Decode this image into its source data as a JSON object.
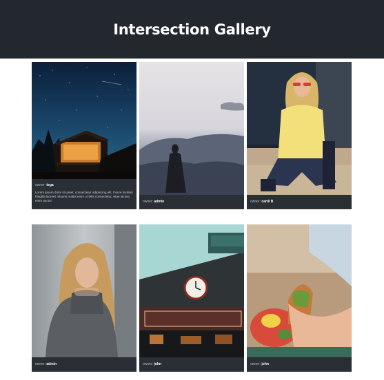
{
  "page": {
    "title": "Intersection Gallery"
  },
  "owner_label": "owner:",
  "cards": [
    {
      "owner": "tega",
      "description": "Lorem ipsum dolor sit amet, consectetur adipiscing elit. Fusce facilisis fringilla laoreet. Mauris mattis enim ut felis consectetur, vitae lacinia enim auctor.",
      "image": "night-sky-cabin"
    },
    {
      "owner": "admin",
      "description": "",
      "image": "silhouette-clouds"
    },
    {
      "owner": "cardi B",
      "description": "",
      "image": "woman-yellow-sweater"
    },
    {
      "owner": "admin",
      "description": "",
      "image": "woman-grey-sweater"
    },
    {
      "owner": "john",
      "description": "",
      "image": "public-market-sign"
    },
    {
      "owner": "john",
      "description": "",
      "image": "picnic-sandwich"
    }
  ]
}
